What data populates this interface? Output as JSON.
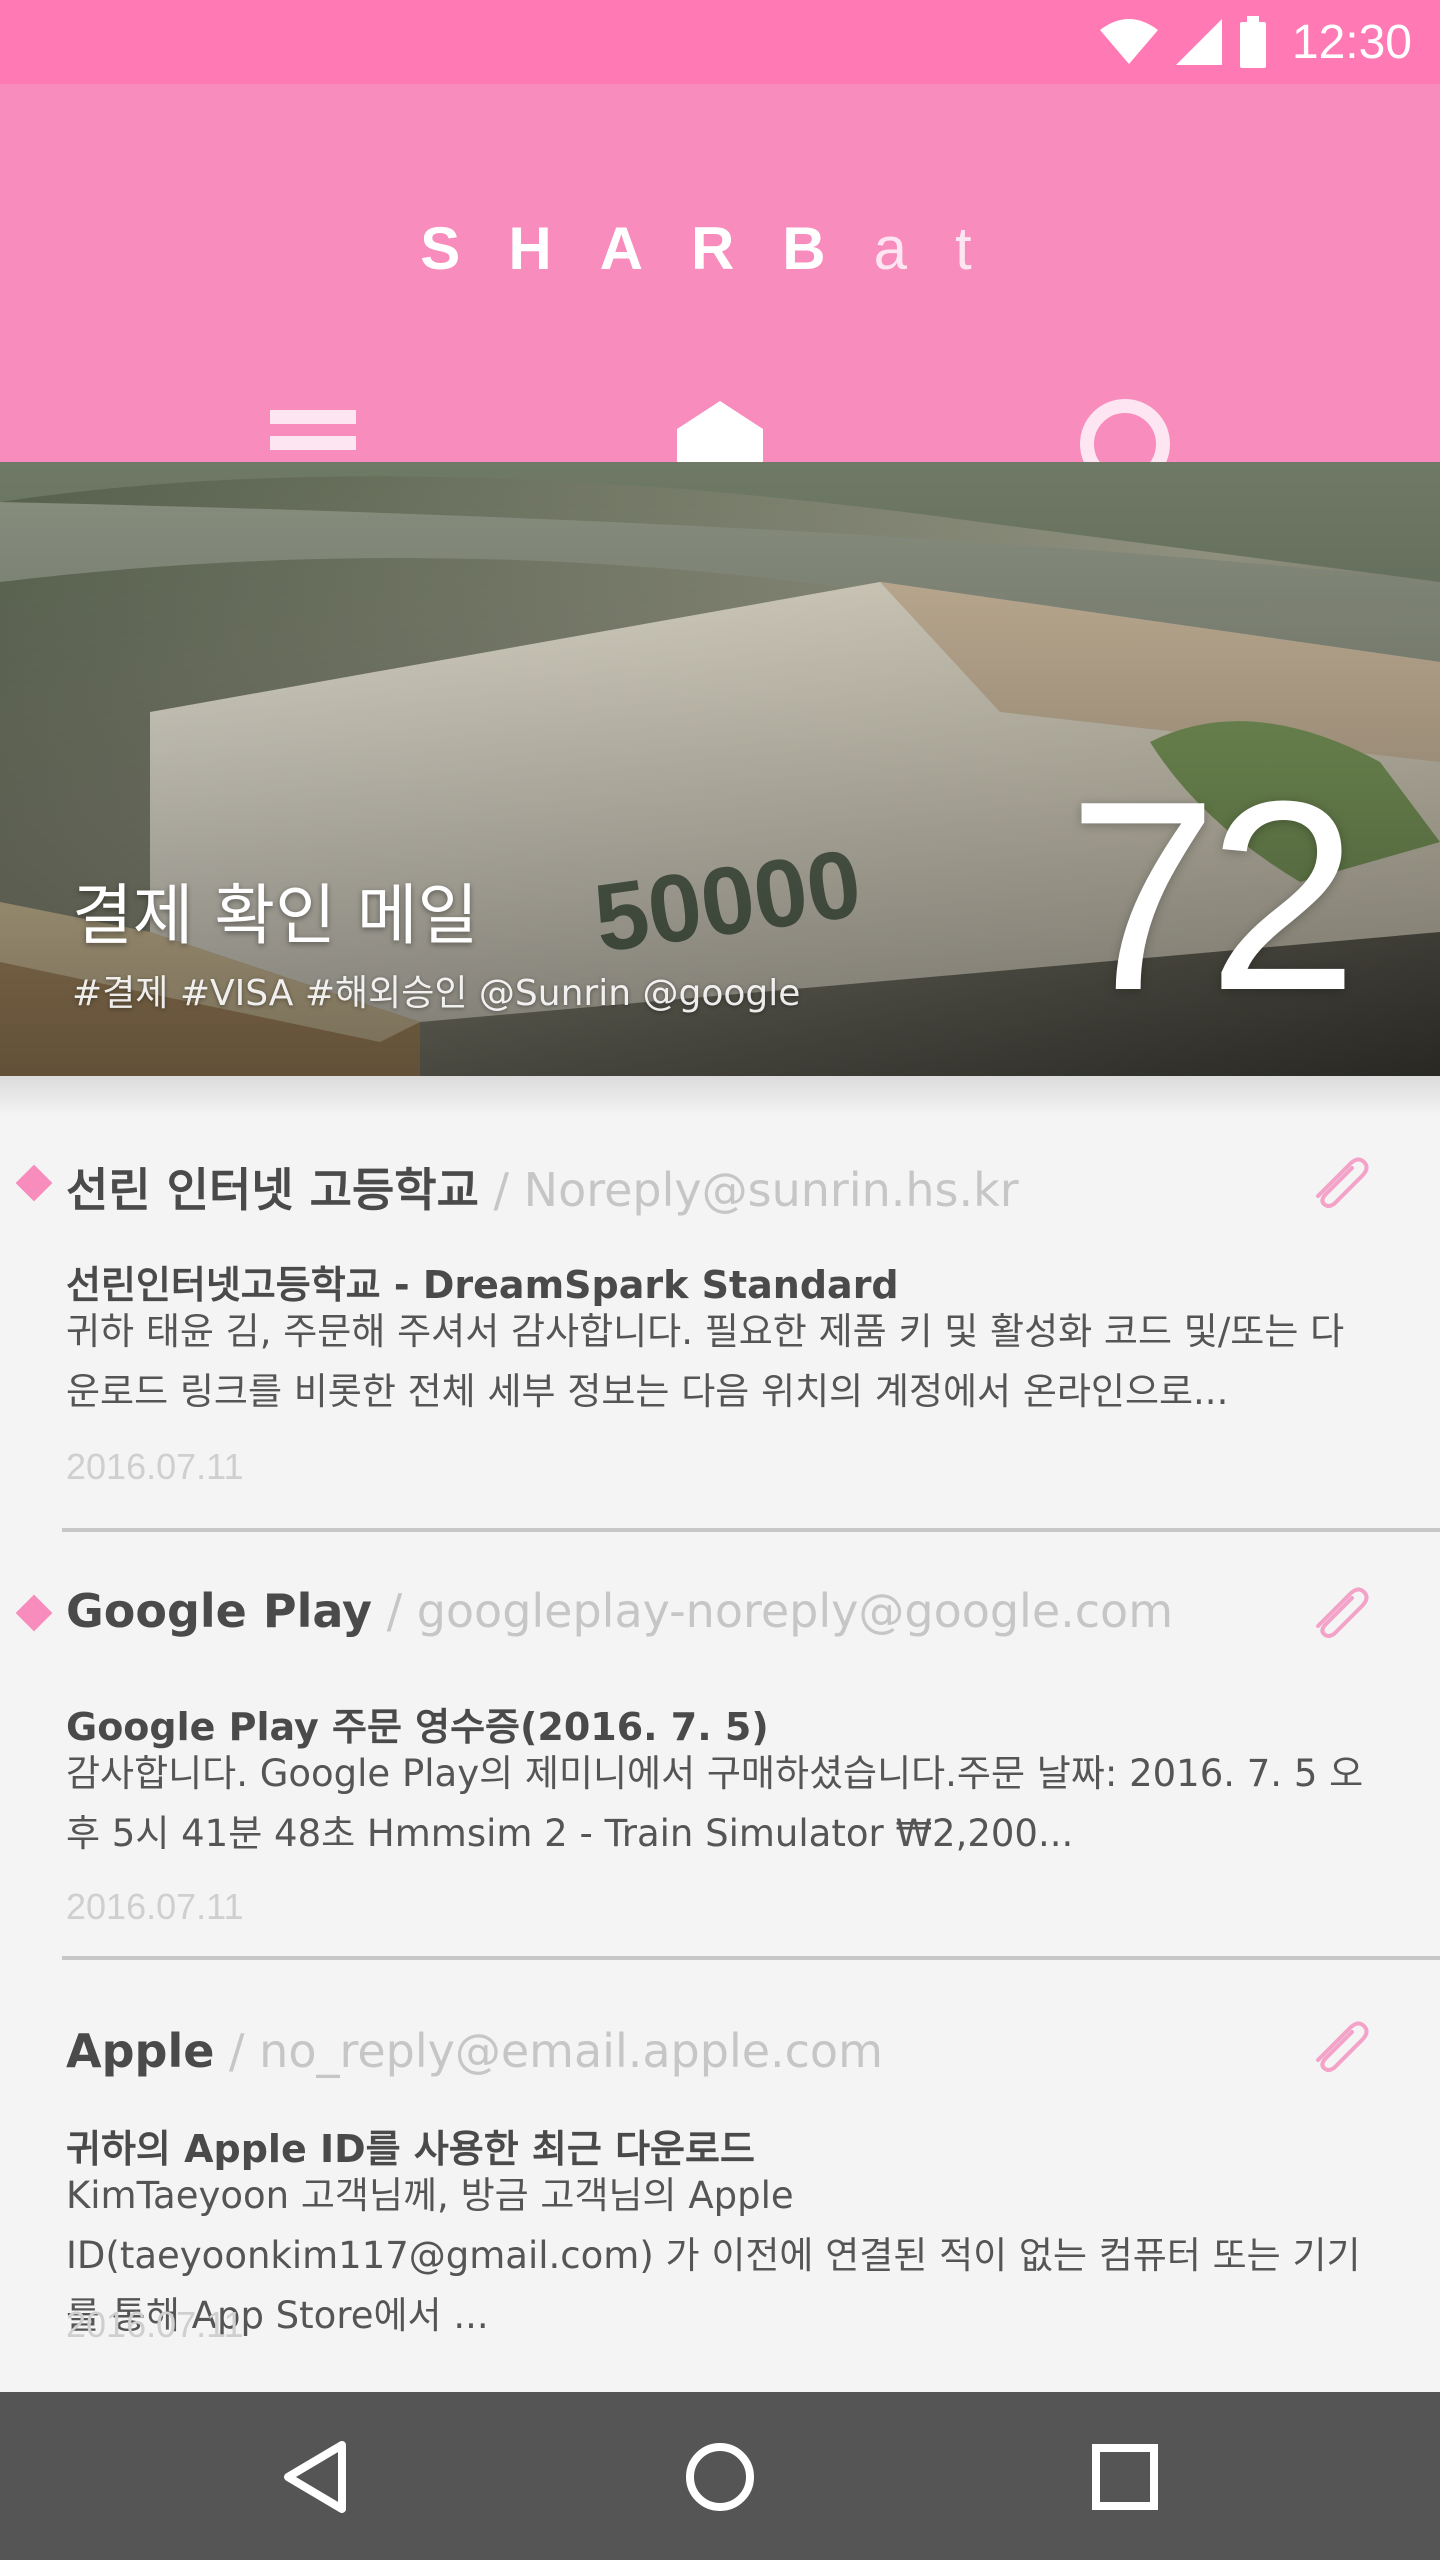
{
  "status_bar": {
    "time": "12:30",
    "icons": [
      "wifi-icon",
      "signal-icon",
      "battery-icon"
    ]
  },
  "app": {
    "title_brand": "SHARB",
    "title_suffix": "at",
    "nav": [
      "menu-icon",
      "home-icon",
      "circle-icon"
    ],
    "accent_color": "#f78cbd",
    "status_color": "#ff79b4"
  },
  "hero": {
    "title": "결제 확인 메일",
    "tags": "#결제 #VISA #해외승인 @Sunrin @google",
    "count": "72"
  },
  "mails": [
    {
      "sender": "선린 인터넷 고등학교",
      "email": "Noreply@sunrin.hs.kr",
      "subject": "선린인터넷고등학교 - DreamSpark Standard",
      "preview": "귀하 태윤 김, 주문해 주셔서 감사합니다. 필요한 제품 키 및 활성화 코드 및/또는 다운로드 링크를 비롯한 전체 세부 정보는 다음 위치의 계정에서 온라인으로...",
      "date": "2016.07.11",
      "unread": true
    },
    {
      "sender": "Google Play",
      "email": "googleplay-noreply@google.com",
      "subject": "Google Play 주문 영수증(2016. 7. 5)",
      "preview": "감사합니다. Google Play의 제미니에서 구매하셨습니다.주문 날짜: 2016. 7. 5 오후 5시 41분 48초 Hmmsim 2 - Train Simulator ₩2,200...",
      "date": "2016.07.11",
      "unread": true
    },
    {
      "sender": "Apple",
      "email": "no_reply@email.apple.com",
      "subject": "귀하의 Apple ID를 사용한 최근 다운로드",
      "preview": "KimTaeyoon 고객님께, 방금 고객님의 Apple ID(taeyoonkim117@gmail.com) 가 이전에 연결된 적이 없는 컴퓨터 또는 기기를 통해 App Store에서 ...",
      "date": "2016.07.11",
      "unread": false
    }
  ],
  "system_nav": [
    "back-icon",
    "home-circle-icon",
    "recents-icon"
  ]
}
